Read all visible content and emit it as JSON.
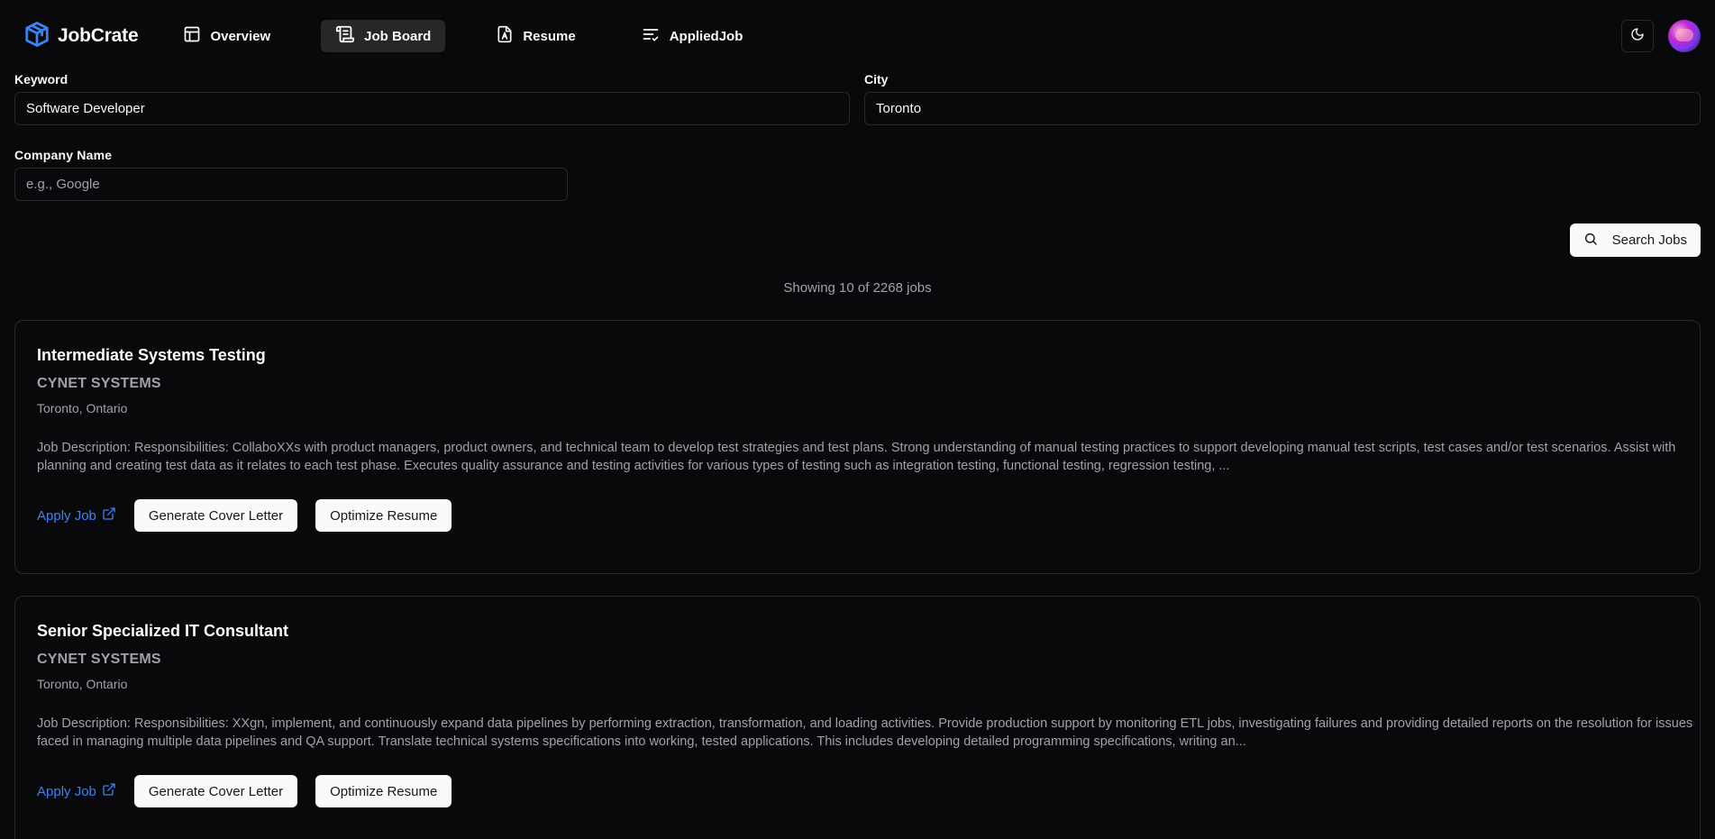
{
  "nav": {
    "brand": "JobCrate",
    "links": [
      {
        "label": "Overview",
        "icon": "layout-icon",
        "active": false
      },
      {
        "label": "Job Board",
        "icon": "scroll-icon",
        "active": true
      },
      {
        "label": "Resume",
        "icon": "file-text-icon",
        "active": false
      },
      {
        "label": "AppliedJob",
        "icon": "list-check-icon",
        "active": false
      }
    ]
  },
  "search": {
    "keyword_label": "Keyword",
    "keyword_value": "Software Developer",
    "city_label": "City",
    "city_value": "Toronto",
    "company_label": "Company Name",
    "company_placeholder": "e.g., Google",
    "button_label": "Search Jobs"
  },
  "results": {
    "summary": "Showing 10 of 2268 jobs"
  },
  "jobs": [
    {
      "title": "Intermediate Systems Testing",
      "company": "CYNET SYSTEMS",
      "location": "Toronto, Ontario",
      "description": "Job Description: Responsibilities: CollaboXXs with product managers, product owners, and technical team to develop test strategies and test plans. Strong understanding of manual testing practices to support developing manual test scripts, test cases and/or test scenarios. Assist with planning and creating test data as it relates to each test phase. Executes quality assurance and testing activities for various types of testing such as integration testing, functional testing, regression testing, ...",
      "apply_label": "Apply Job",
      "cover_label": "Generate Cover Letter",
      "optimize_label": "Optimize Resume"
    },
    {
      "title": "Senior Specialized IT Consultant",
      "company": "CYNET SYSTEMS",
      "location": "Toronto, Ontario",
      "description": "Job Description: Responsibilities: XXgn, implement, and continuously expand data pipelines by performing extraction, transformation, and loading activities. Provide production support by monitoring ETL jobs, investigating failures and providing detailed reports on the resolution for issues faced in managing multiple data pipelines and QA support. Translate technical systems specifications into working, tested applications. This includes developing detailed programming specifications, writing an...",
      "apply_label": "Apply Job",
      "cover_label": "Generate Cover Letter",
      "optimize_label": "Optimize Resume"
    }
  ],
  "colors": {
    "background": "#09090b",
    "border": "#27272a",
    "muted_text": "#a1a1aa",
    "link": "#3b82f6",
    "brand_icon": "#3b82f6"
  }
}
